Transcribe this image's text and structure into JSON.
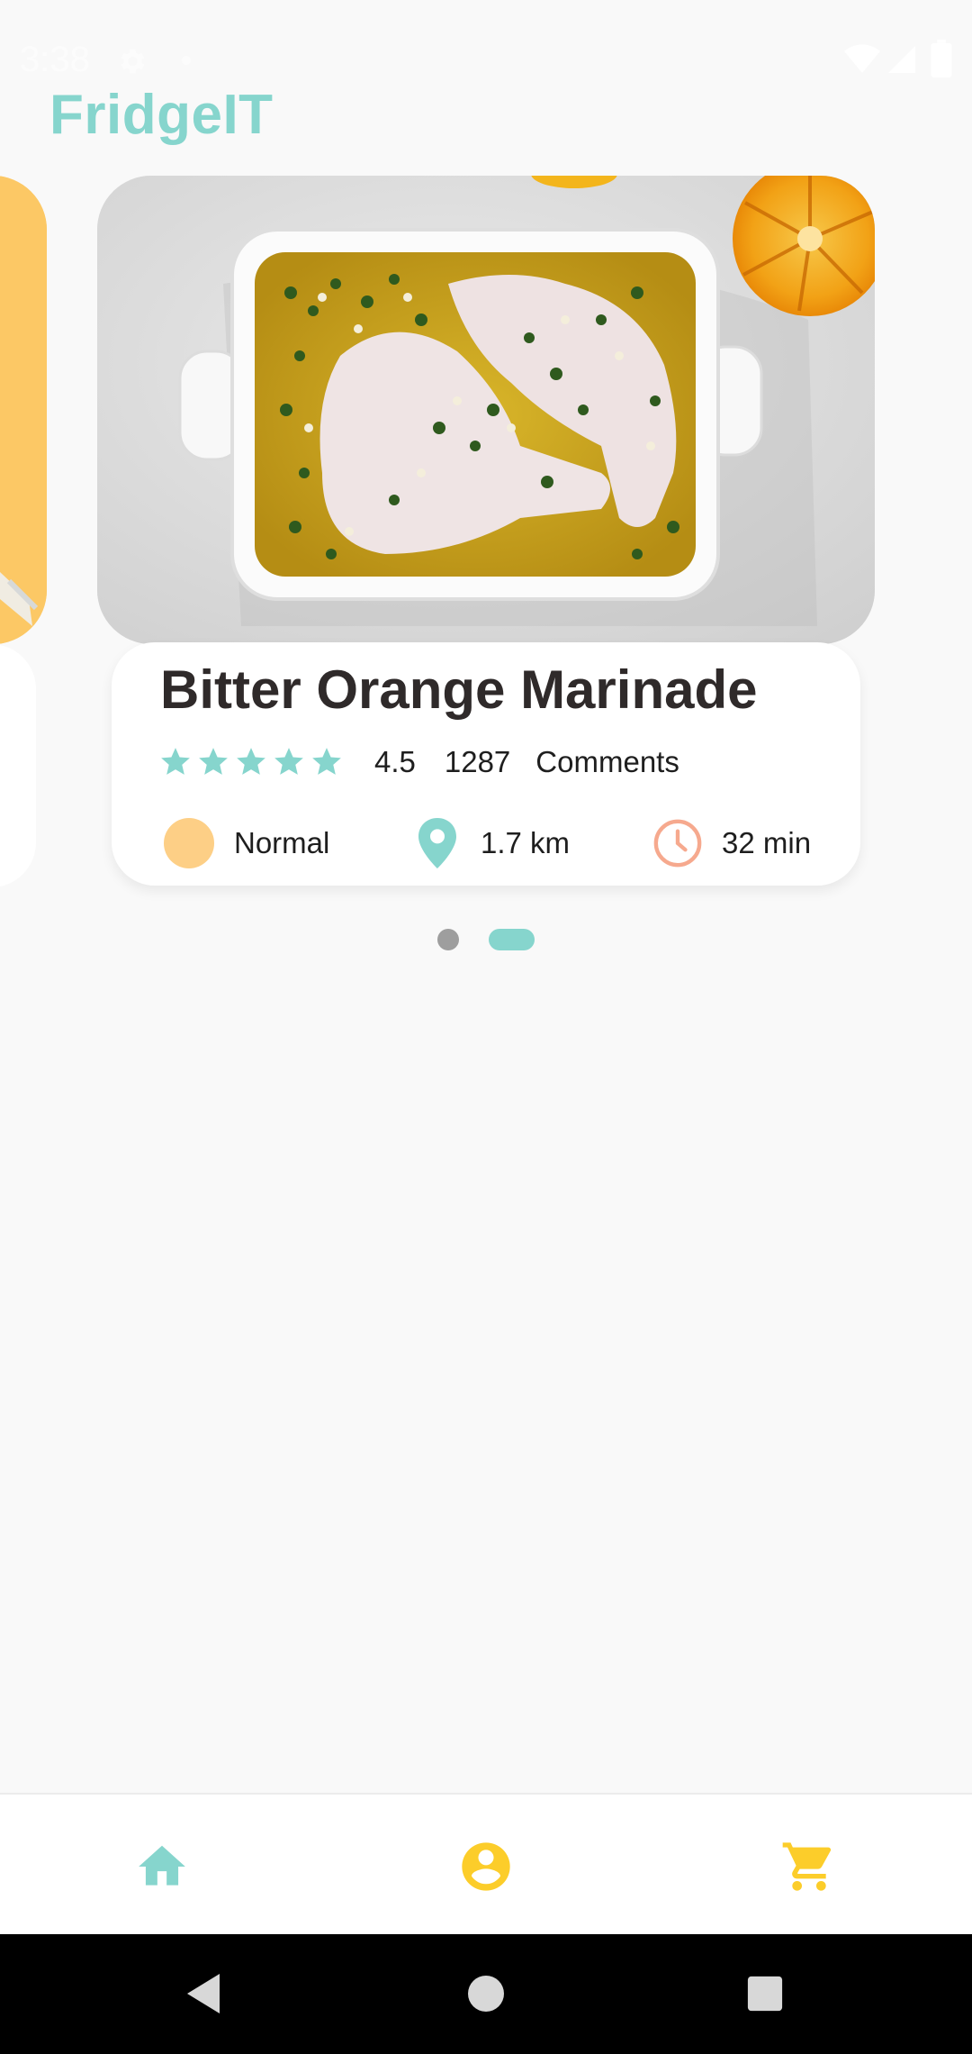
{
  "status_bar": {
    "time": "3:38",
    "icons": [
      "gear-icon",
      "dot-icon",
      "wifi-icon",
      "signal-icon",
      "battery-icon"
    ]
  },
  "app": {
    "title": "FridgeIT",
    "accent_color": "#86d5cd",
    "secondary_color": "#fcc865"
  },
  "carousel": {
    "page_count": 2,
    "active_page": 2,
    "active_card": {
      "title": "Bitter Orange Marinade",
      "stars_icon": "star-icon",
      "star_count": 5,
      "rating": "4.5",
      "comment_count": "1287",
      "comments_label": "Comments",
      "difficulty": "Normal",
      "difficulty_color": "#fdcf86",
      "distance": "1.7 km",
      "time": "32 min"
    }
  },
  "bottom_nav": {
    "items": [
      {
        "icon": "home-icon",
        "color": "#86d5cd"
      },
      {
        "icon": "account-icon",
        "color": "#fccd2a"
      },
      {
        "icon": "cart-icon",
        "color": "#fccd2a"
      }
    ]
  },
  "system_nav": {
    "items": [
      "back-icon",
      "home-circle-icon",
      "recents-icon"
    ]
  }
}
